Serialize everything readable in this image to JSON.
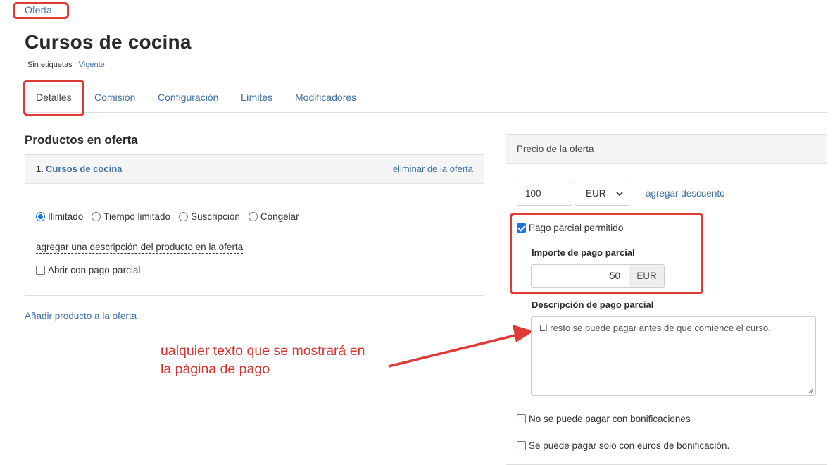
{
  "breadcrumb": "Oferta",
  "title": "Cursos de cocina",
  "tags": {
    "none": "Sin etiquetas",
    "status": "Vigente"
  },
  "tabs": [
    {
      "label": "Detalles"
    },
    {
      "label": "Comisión"
    },
    {
      "label": "Configuración"
    },
    {
      "label": "Límites"
    },
    {
      "label": "Modificadores"
    }
  ],
  "products": {
    "title": "Productos en oferta",
    "item": {
      "number": "1.",
      "name": "Cursos de cocina",
      "remove": "eliminar de la oferta",
      "access_options": [
        "Ilimitado",
        "Tiempo limitado",
        "Suscripción",
        "Congelar"
      ],
      "selected_option": "Ilimitado",
      "add_description": "agregar una descripción del producto en la oferta",
      "open_partial": "Abrir con pago parcial"
    },
    "add_product": "Añadir producto a la oferta"
  },
  "annotation": {
    "line1": "ualquier texto que se mostrará en",
    "line2": "la página de pago"
  },
  "price": {
    "header": "Precio de la oferta",
    "amount": "100",
    "currency": "EUR",
    "add_discount": "agregar descuento",
    "partial_allowed": "Pago parcial permitido",
    "partial_amount_label": "Importe de pago parcial",
    "partial_amount": "50",
    "partial_currency": "EUR",
    "partial_desc_label": "Descripción de pago parcial",
    "partial_desc": "El resto se puede pagar antes de que comience el curso.",
    "no_bonus": "No se puede pagar con bonificaciones",
    "only_bonus": "Se puede pagar solo con euros de bonificación."
  },
  "colors": {
    "accent": "#3d6fa6",
    "annotation_red": "#e03a35",
    "checkbox_blue": "#1a73e8"
  }
}
